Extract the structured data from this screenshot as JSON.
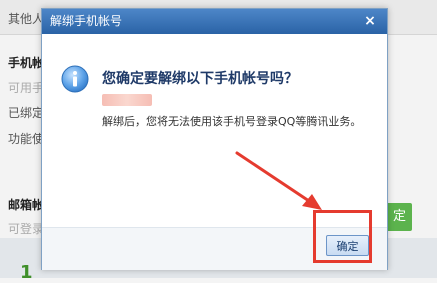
{
  "background": {
    "lines": [
      {
        "text": "其他人",
        "style": "plain"
      },
      {
        "text": "手机帐号",
        "style": "bold"
      },
      {
        "text": "可用手",
        "style": "gray"
      },
      {
        "text": "已绑定",
        "style": "plain"
      },
      {
        "text": "功能使",
        "style": "plain"
      },
      {
        "text": "邮箱帐",
        "style": "bold"
      },
      {
        "text": "可登录",
        "style": "gray"
      }
    ],
    "green_button_label": "定",
    "bottom_number": "1"
  },
  "dialog": {
    "title": "解绑手机帐号",
    "close_symbol": "×",
    "question": "您确定要解绑以下手机帐号吗？",
    "note": "解绑后，您将无法使用该手机号登录QQ等腾讯业务。",
    "confirm_label": "确定",
    "icon": "info-icon"
  },
  "annotation": {
    "arrow_color": "#e53b2f",
    "box_color": "#e53b2f"
  }
}
